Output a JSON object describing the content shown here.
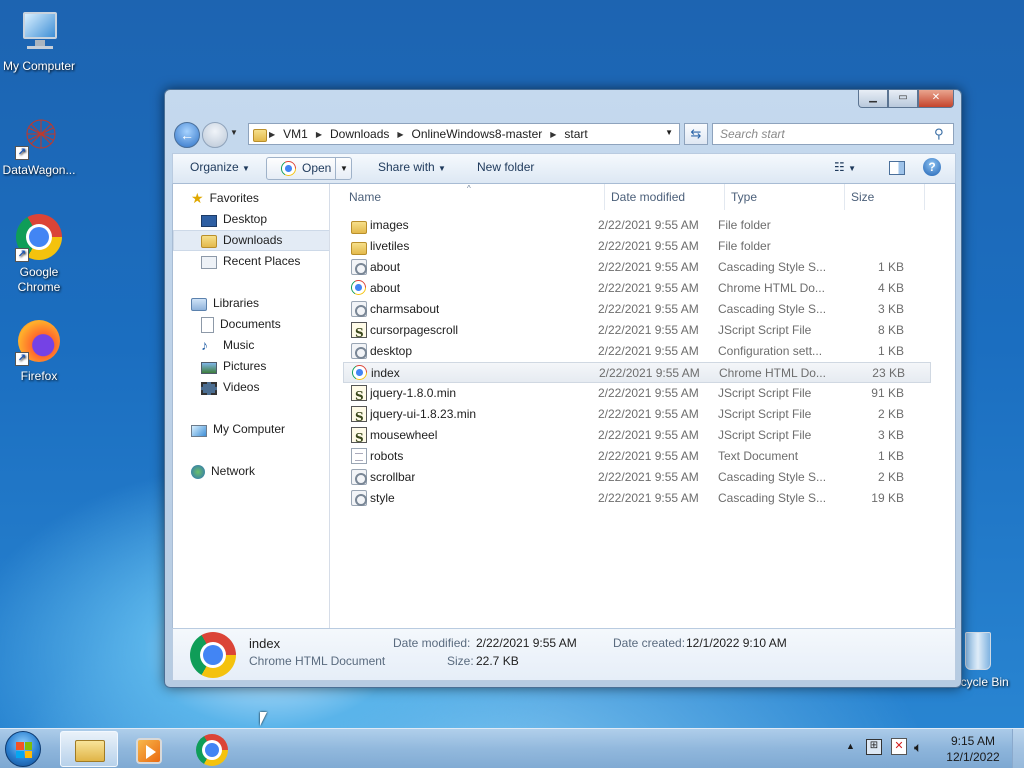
{
  "desktop": {
    "icons": [
      {
        "label": "My Computer",
        "icon": "computer-icon"
      },
      {
        "label": "DataWagon...",
        "icon": "datawagon-icon"
      },
      {
        "label": "Google Chrome",
        "icon": "chrome-icon"
      },
      {
        "label": "Firefox",
        "icon": "firefox-icon"
      },
      {
        "label": "Recycle Bin",
        "icon": "recycle-bin-icon"
      }
    ]
  },
  "explorer": {
    "address": {
      "crumbs": [
        "VM1",
        "Downloads",
        "OnlineWindows8-master",
        "start"
      ]
    },
    "search": {
      "placeholder": "Search start"
    },
    "toolbar": {
      "organize": "Organize",
      "open": "Open",
      "share_with": "Share with",
      "new_folder": "New folder"
    },
    "nav": {
      "favorites": {
        "label": "Favorites",
        "items": [
          "Desktop",
          "Downloads",
          "Recent Places"
        ],
        "selected": "Downloads"
      },
      "libraries": {
        "label": "Libraries",
        "items": [
          "Documents",
          "Music",
          "Pictures",
          "Videos"
        ]
      },
      "computer": "My Computer",
      "network": "Network"
    },
    "columns": {
      "name": "Name",
      "date": "Date modified",
      "type": "Type",
      "size": "Size"
    },
    "files": [
      {
        "name": "images",
        "date": "2/22/2021 9:55 AM",
        "type": "File folder",
        "size": "",
        "kind": "folder"
      },
      {
        "name": "livetiles",
        "date": "2/22/2021 9:55 AM",
        "type": "File folder",
        "size": "",
        "kind": "folder"
      },
      {
        "name": "about",
        "date": "2/22/2021 9:55 AM",
        "type": "Cascading Style S...",
        "size": "1 KB",
        "kind": "css"
      },
      {
        "name": "about",
        "date": "2/22/2021 9:55 AM",
        "type": "Chrome HTML Do...",
        "size": "4 KB",
        "kind": "html"
      },
      {
        "name": "charmsabout",
        "date": "2/22/2021 9:55 AM",
        "type": "Cascading Style S...",
        "size": "3 KB",
        "kind": "css"
      },
      {
        "name": "cursorpagescroll",
        "date": "2/22/2021 9:55 AM",
        "type": "JScript Script File",
        "size": "8 KB",
        "kind": "js"
      },
      {
        "name": "desktop",
        "date": "2/22/2021 9:55 AM",
        "type": "Configuration sett...",
        "size": "1 KB",
        "kind": "css"
      },
      {
        "name": "index",
        "date": "2/22/2021 9:55 AM",
        "type": "Chrome HTML Do...",
        "size": "23 KB",
        "kind": "html",
        "selected": true
      },
      {
        "name": "jquery-1.8.0.min",
        "date": "2/22/2021 9:55 AM",
        "type": "JScript Script File",
        "size": "91 KB",
        "kind": "js"
      },
      {
        "name": "jquery-ui-1.8.23.min",
        "date": "2/22/2021 9:55 AM",
        "type": "JScript Script File",
        "size": "2 KB",
        "kind": "js"
      },
      {
        "name": "mousewheel",
        "date": "2/22/2021 9:55 AM",
        "type": "JScript Script File",
        "size": "3 KB",
        "kind": "js"
      },
      {
        "name": "robots",
        "date": "2/22/2021 9:55 AM",
        "type": "Text Document",
        "size": "1 KB",
        "kind": "txt"
      },
      {
        "name": "scrollbar",
        "date": "2/22/2021 9:55 AM",
        "type": "Cascading Style S...",
        "size": "2 KB",
        "kind": "css"
      },
      {
        "name": "style",
        "date": "2/22/2021 9:55 AM",
        "type": "Cascading Style S...",
        "size": "19 KB",
        "kind": "css"
      }
    ],
    "details": {
      "name": "index",
      "type": "Chrome HTML Document",
      "modified_label": "Date modified:",
      "modified_value": "2/22/2021 9:55 AM",
      "size_label": "Size:",
      "size_value": "22.7 KB",
      "created_label": "Date created:",
      "created_value": "12/1/2022 9:10 AM"
    }
  },
  "taskbar": {
    "time": "9:15 AM",
    "date": "12/1/2022",
    "pinned": [
      "explorer-icon",
      "media-player-icon",
      "chrome-icon"
    ]
  }
}
